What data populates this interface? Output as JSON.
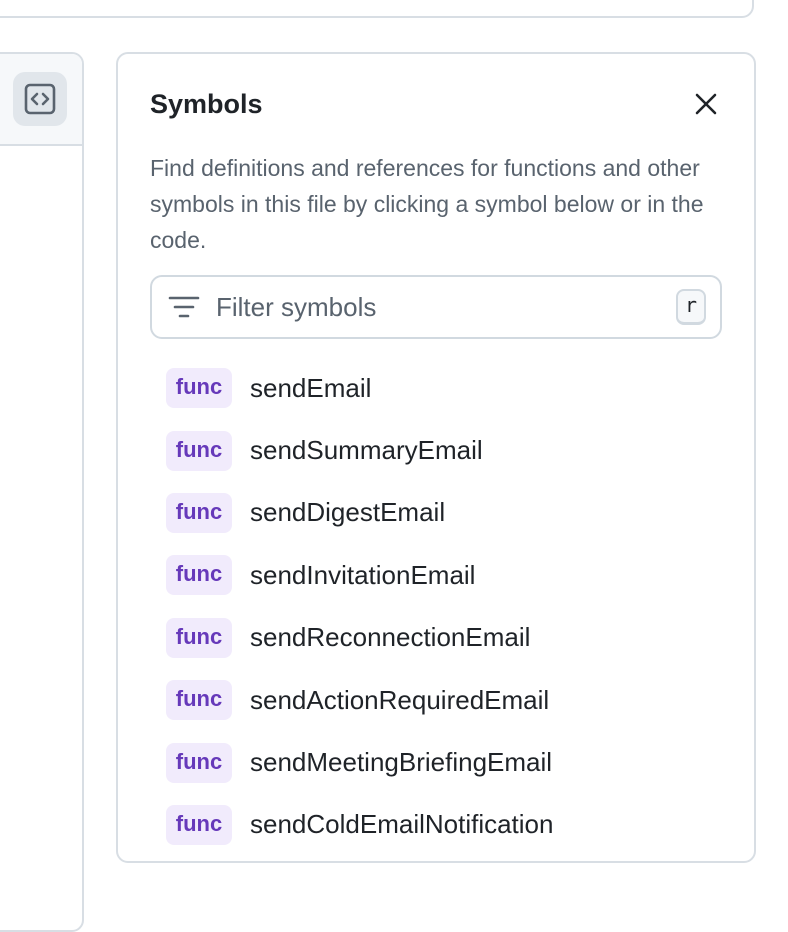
{
  "symbols_panel": {
    "title": "Symbols",
    "description": "Find definitions and references for functions and other symbols in this file by clicking a symbol below or in the code.",
    "filter": {
      "placeholder": "Filter symbols",
      "value": "",
      "shortcut": "r"
    },
    "items": [
      {
        "kind": "func",
        "name": "sendEmail"
      },
      {
        "kind": "func",
        "name": "sendSummaryEmail"
      },
      {
        "kind": "func",
        "name": "sendDigestEmail"
      },
      {
        "kind": "func",
        "name": "sendInvitationEmail"
      },
      {
        "kind": "func",
        "name": "sendReconnectionEmail"
      },
      {
        "kind": "func",
        "name": "sendActionRequiredEmail"
      },
      {
        "kind": "func",
        "name": "sendMeetingBriefingEmail"
      },
      {
        "kind": "func",
        "name": "sendColdEmailNotification"
      }
    ]
  },
  "icons": {
    "code_toggle": "code-icon",
    "close": "close-icon",
    "filter": "filter-icon"
  },
  "colors": {
    "func_badge_text": "#6639ba",
    "func_badge_bg": "#f1ebfc",
    "border": "#d8dee4",
    "muted_text": "#59636e"
  }
}
